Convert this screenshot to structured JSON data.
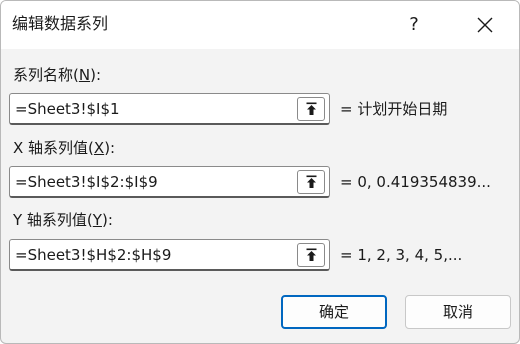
{
  "dialog": {
    "title": "编辑数据系列",
    "help_label": "?",
    "close_icon": "close-icon"
  },
  "fields": [
    {
      "label_prefix": "系列名称(",
      "label_key": "N",
      "label_suffix": "):",
      "value": "=Sheet3!$I$1",
      "preview": "= 计划开始日期"
    },
    {
      "label_prefix": "X 轴系列值(",
      "label_key": "X",
      "label_suffix": "):",
      "value": "=Sheet3!$I$2:$I$9",
      "preview": "= 0, 0.419354839..."
    },
    {
      "label_prefix": "Y 轴系列值(",
      "label_key": "Y",
      "label_suffix": "):",
      "value": "=Sheet3!$H$2:$H$9",
      "preview": "= 1, 2, 3, 4, 5,..."
    }
  ],
  "buttons": {
    "ok": "确定",
    "cancel": "取消"
  },
  "icons": {
    "range_select": "collapse-dialog-icon"
  }
}
